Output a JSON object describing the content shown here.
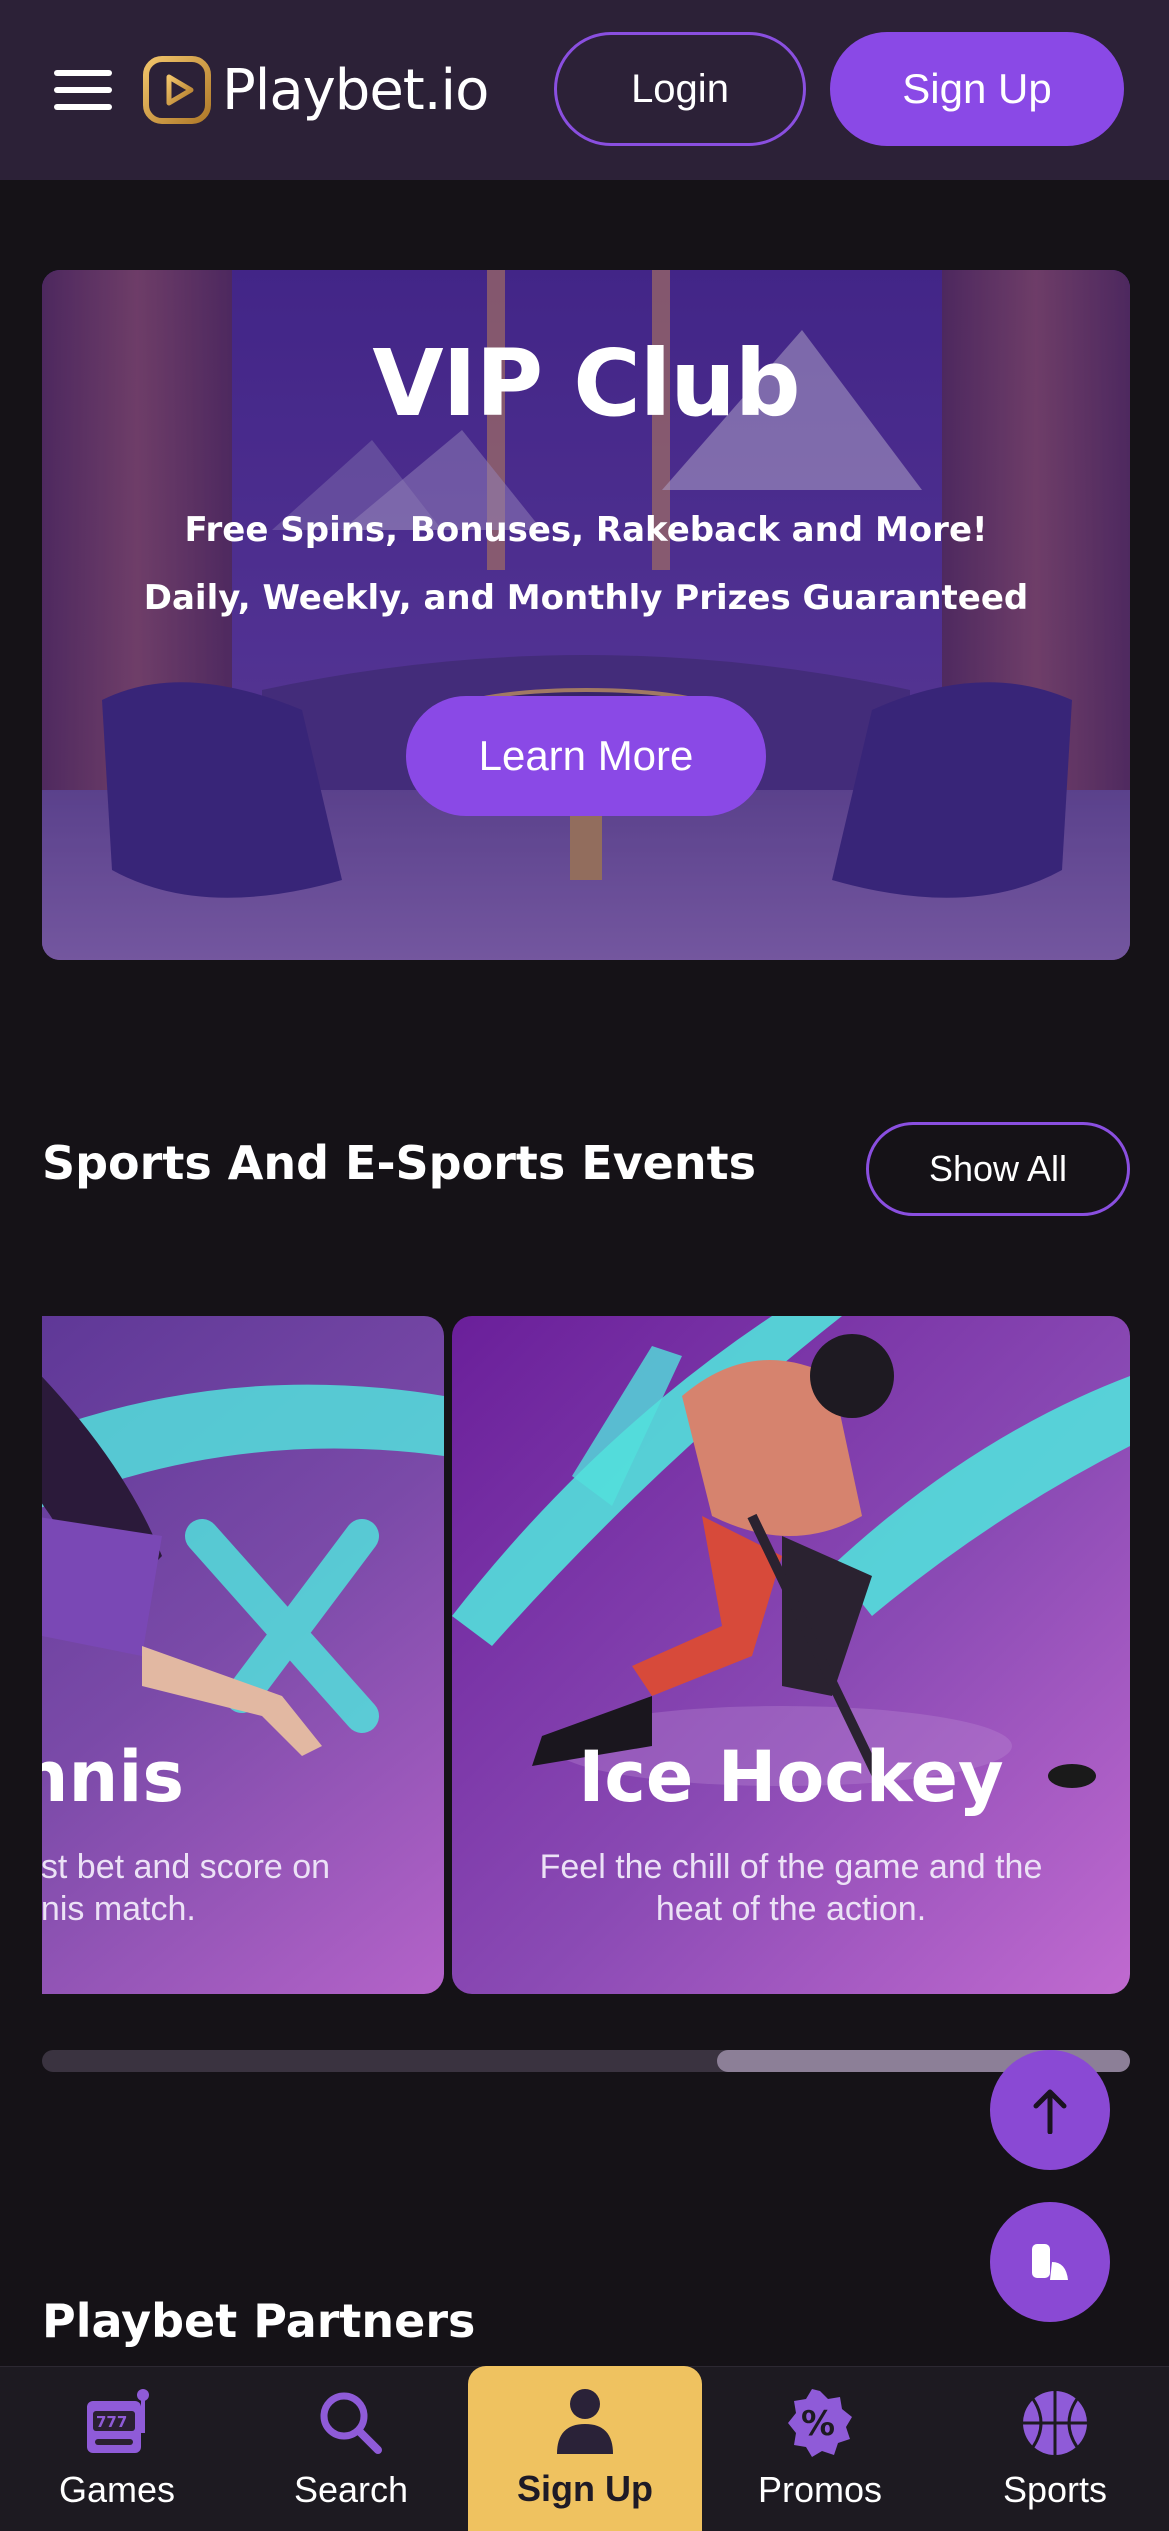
{
  "header": {
    "logo_text": "Playbet.io",
    "login_label": "Login",
    "signup_label": "Sign Up",
    "menu_icon": "hamburger-menu-icon",
    "brand_colors": {
      "accent": "#8a49e6",
      "header_bg": "#2c2137",
      "logo_gold": "#d9a441"
    }
  },
  "vip_banner": {
    "title": "VIP Club",
    "line1": "Free Spins, Bonuses, Rakeback and More!",
    "line2": "Daily, Weekly, and Monthly Prizes Guaranteed",
    "cta_label": "Learn More"
  },
  "sports_section": {
    "title": "Sports And E-Sports Events",
    "show_all_label": "Show All",
    "cards": [
      {
        "title": "Tennis",
        "visible_title": "nnis",
        "visible_desc_lines": [
          "est bet and score on",
          "nnis match."
        ]
      },
      {
        "title": "Ice Hockey",
        "desc_lines": [
          "Feel the chill of the game and the",
          "heat of the action."
        ]
      }
    ],
    "scroll_position": 0.62
  },
  "floating_buttons": {
    "scroll_top_icon": "arrow-up-icon",
    "help_icon": "support-chat-icon"
  },
  "partners_section": {
    "title": "Playbet Partners"
  },
  "bottom_nav": {
    "items": [
      {
        "label": "Games",
        "icon": "slot-machine-icon"
      },
      {
        "label": "Search",
        "icon": "search-icon"
      },
      {
        "label": "Sign Up",
        "icon": "user-icon",
        "highlight_color": "#efc260"
      },
      {
        "label": "Promos",
        "icon": "percent-badge-icon"
      },
      {
        "label": "Sports",
        "icon": "basketball-icon"
      }
    ]
  }
}
